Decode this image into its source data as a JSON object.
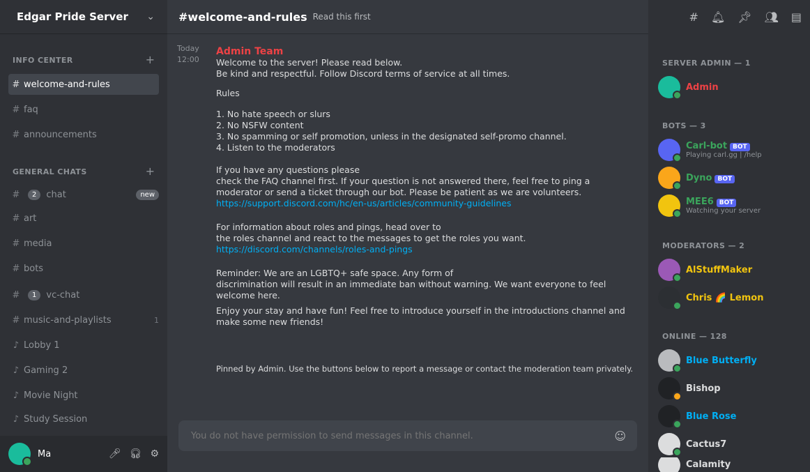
{
  "sidebar": {
    "server_name": "Edgar Pride Server",
    "categories": [
      {
        "label": "Info Center"
      },
      {
        "label": "General Chats"
      }
    ],
    "channels": [
      {
        "label": "welcome-and-rules",
        "type": "text",
        "active": true
      },
      {
        "label": "faq",
        "type": "text"
      },
      {
        "label": "announcements",
        "type": "text"
      },
      {
        "label": "chat",
        "type": "text",
        "badge": "2",
        "badge_after": "new"
      },
      {
        "label": "art",
        "type": "text"
      },
      {
        "label": "media",
        "type": "text"
      },
      {
        "label": "bots",
        "type": "text"
      },
      {
        "label": "vc-chat",
        "type": "text",
        "badge": "1"
      },
      {
        "label": "music-and-playlists",
        "type": "text",
        "count": "1"
      },
      {
        "label": "Lobby 1",
        "type": "voice"
      },
      {
        "label": "Gaming 2",
        "type": "voice"
      },
      {
        "label": "Movie Night",
        "type": "voice"
      },
      {
        "label": "Study Session",
        "type": "voice"
      }
    ],
    "user": {
      "name": "Ma"
    }
  },
  "channel": {
    "name": "#welcome-and-rules",
    "topic": "Read this first"
  },
  "message": {
    "date_label": "Today",
    "time_label": "12:00",
    "author": "Admin Team",
    "lines": [
      "Welcome to the server! Please read below.",
      "Be kind and respectful. Follow Discord terms of service at all times.",
      "Rules",
      "1. No hate speech or slurs",
      "2. No NSFW content",
      "3. No spamming or self promotion, unless in the designated self-promo channel.",
      "4. Listen to the moderators",
      "If you have any questions please",
      "check the FAQ channel first. If your question is not answered there, feel free to ping a moderator or send a ticket through our bot. Please be patient as we are volunteers.",
      "https://support.discord.com/hc/en-us/articles/community-guidelines",
      "For information about roles and pings, head over to",
      "the roles channel and react to the messages to get the roles you want.",
      "https://discord.com/channels/roles-and-pings",
      "Reminder: We are an LGBTQ+ safe space. Any form of",
      "discrimination will result in an immediate ban without warning. We want everyone to feel welcome here.",
      "Enjoy your stay and have fun! Feel free to introduce yourself in the introductions channel and make some new friends!",
      "Pinned by Admin. Use the buttons below to report a message or contact the moderation team privately."
    ]
  },
  "composer": {
    "placeholder": "You do not have permission to send messages in this channel."
  },
  "members": {
    "groups": [
      {
        "label": "Server Admin — 1"
      },
      {
        "label": "Bots — 3"
      },
      {
        "label": "Moderators — 2"
      },
      {
        "label": "Online — 128"
      }
    ],
    "list": [
      {
        "name": "Admin",
        "color": "#ed4245",
        "avatar": "#1abc9c",
        "status": "#3ba55c"
      },
      {
        "name": "Carl-bot",
        "sub": "Playing carl.gg | /help",
        "color": "#3ba55c",
        "avatar": "#5865f2",
        "status": "#3ba55c",
        "bot": "BOT"
      },
      {
        "name": "Dyno",
        "color": "#3ba55c",
        "avatar": "#faa61a",
        "status": "#3ba55c",
        "bot": "BOT"
      },
      {
        "name": "MEE6",
        "sub": "Watching your server",
        "color": "#3ba55c",
        "avatar": "#f1c40f",
        "status": "#3ba55c",
        "bot": "BOT"
      },
      {
        "name": "AlStuffMaker",
        "color": "#f1c40f",
        "avatar": "#9b59b6",
        "status": "#3ba55c"
      },
      {
        "name": "Chris 🌈 Lemon",
        "color": "#f1c40f",
        "avatar": "#2c2f33",
        "status": "#3ba55c"
      },
      {
        "name": "Blue Butterfly",
        "color": "#00aff4",
        "avatar": "#b9bbbe",
        "status": "#3ba55c"
      },
      {
        "name": "Bishop",
        "color": "#dcddde",
        "avatar": "#202225",
        "status": "#faa61a"
      },
      {
        "name": "Blue Rose",
        "color": "#00aff4",
        "avatar": "#202225",
        "status": "#3ba55c"
      },
      {
        "name": "Cactus7",
        "color": "#dcddde",
        "avatar": "#dcddde",
        "status": "#3ba55c"
      },
      {
        "name": "Calamity",
        "color": "#dcddde",
        "avatar": "#dcddde",
        "status": "#3ba55c"
      }
    ]
  }
}
